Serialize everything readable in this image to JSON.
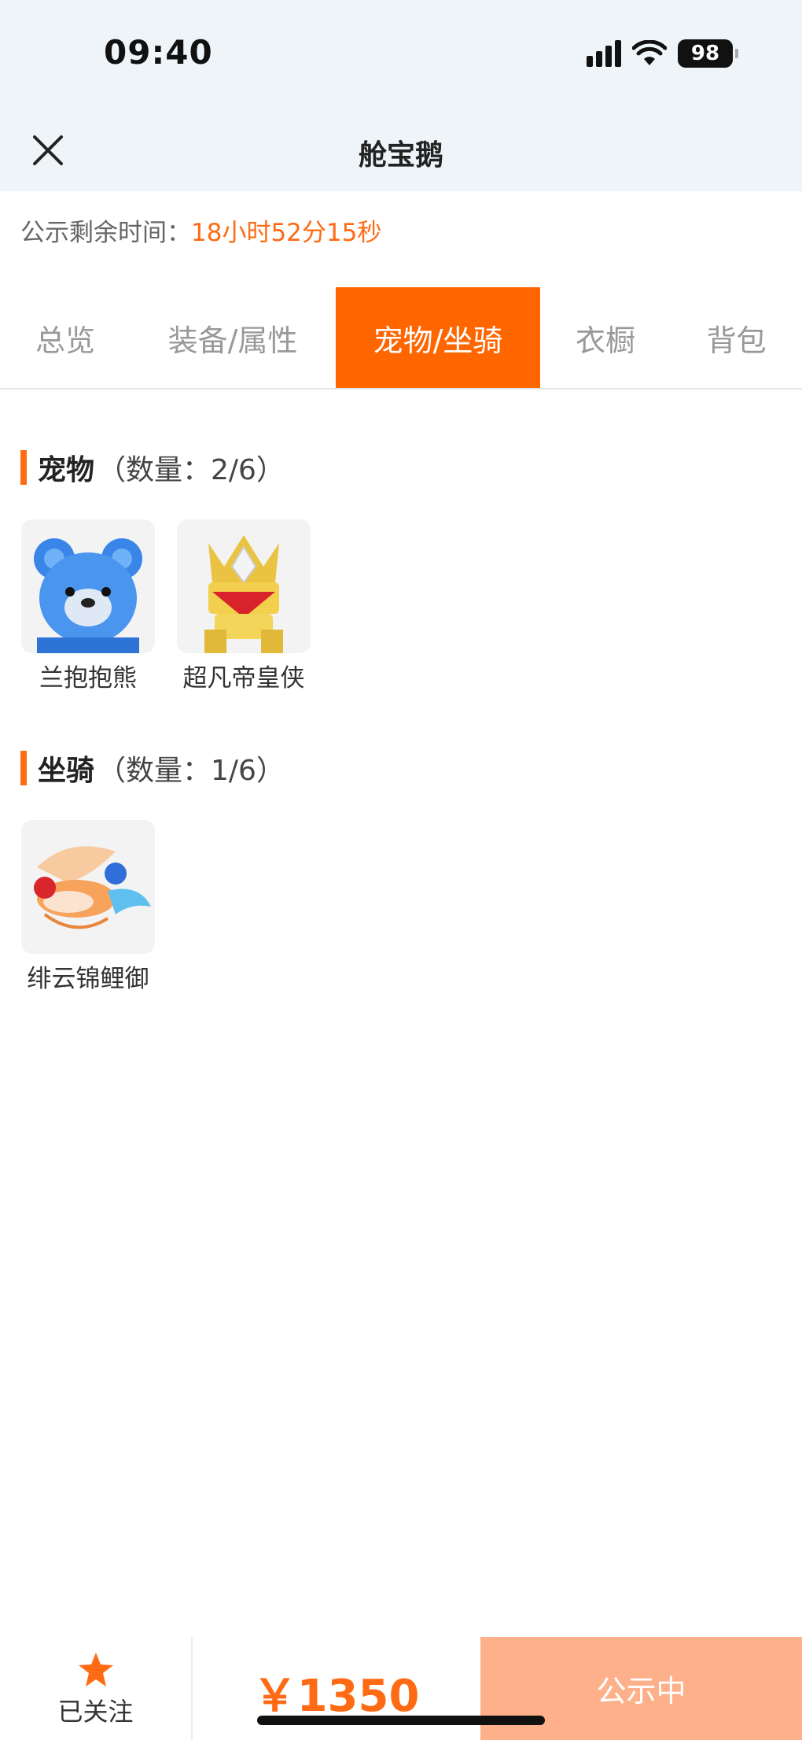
{
  "status_bar": {
    "time": "09:40",
    "battery": "98"
  },
  "header": {
    "title": "舱宝鹅"
  },
  "timer": {
    "label": "公示剩余时间：",
    "value": "18小时52分15秒"
  },
  "tabs": [
    {
      "label": "总览",
      "active": false
    },
    {
      "label": "装备/属性",
      "active": false
    },
    {
      "label": "宠物/坐骑",
      "active": true
    },
    {
      "label": "衣橱",
      "active": false
    },
    {
      "label": "背包",
      "active": false
    }
  ],
  "pets": {
    "title": "宠物",
    "count_text": "（数量：2/6）",
    "items": [
      {
        "name": "兰抱抱熊",
        "icon": "blue-bear-pet-icon"
      },
      {
        "name": "超凡帝皇侠",
        "icon": "golden-armor-pet-icon"
      }
    ]
  },
  "mounts": {
    "title": "坐骑",
    "count_text": "（数量：1/6）",
    "items": [
      {
        "name": "绯云锦鲤御",
        "icon": "koi-fish-mount-icon"
      }
    ]
  },
  "bottom": {
    "follow_label": "已关注",
    "price": "￥1350",
    "status_label": "公示中"
  },
  "colors": {
    "accent": "#ff6600",
    "price": "#ff6a14",
    "status_button": "#fdb08a",
    "top_background": "#eef4f7"
  }
}
